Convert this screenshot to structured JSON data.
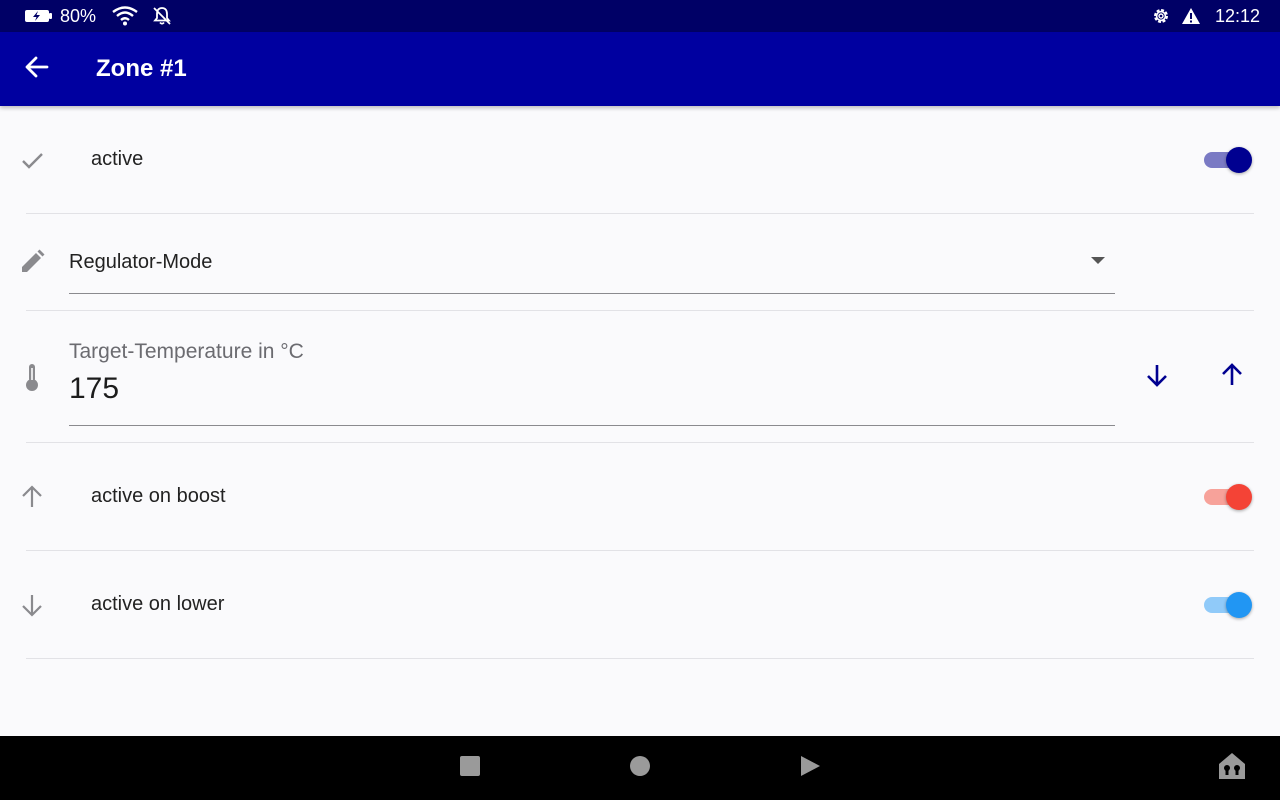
{
  "status_bar": {
    "battery_percent": "80%",
    "time": "12:12"
  },
  "app_bar": {
    "title": "Zone #1"
  },
  "settings": {
    "active": {
      "label": "active",
      "enabled": true,
      "color": "#000090",
      "track_color": "#7a7ac4"
    },
    "regulator_mode": {
      "value": "Regulator-Mode"
    },
    "target_temperature": {
      "label": "Target-Temperature in °C",
      "value": "175"
    },
    "active_on_boost": {
      "label": "active on boost",
      "enabled": true,
      "color": "#f44336",
      "track_color": "#f7a29a"
    },
    "active_on_lower": {
      "label": "active on lower",
      "enabled": true,
      "color": "#2196f3",
      "track_color": "#90caf9"
    }
  },
  "icons": {
    "back": "arrow-left-icon",
    "active": "check-icon",
    "mode": "pencil-icon",
    "temperature": "thermometer-icon",
    "boost": "arrow-up-icon",
    "lower": "arrow-down-icon",
    "decrement": "arrow-down-icon",
    "increment": "arrow-up-icon"
  },
  "colors": {
    "status_bar": "#000066",
    "app_bar": "#0000a0",
    "accent": "#000090"
  }
}
